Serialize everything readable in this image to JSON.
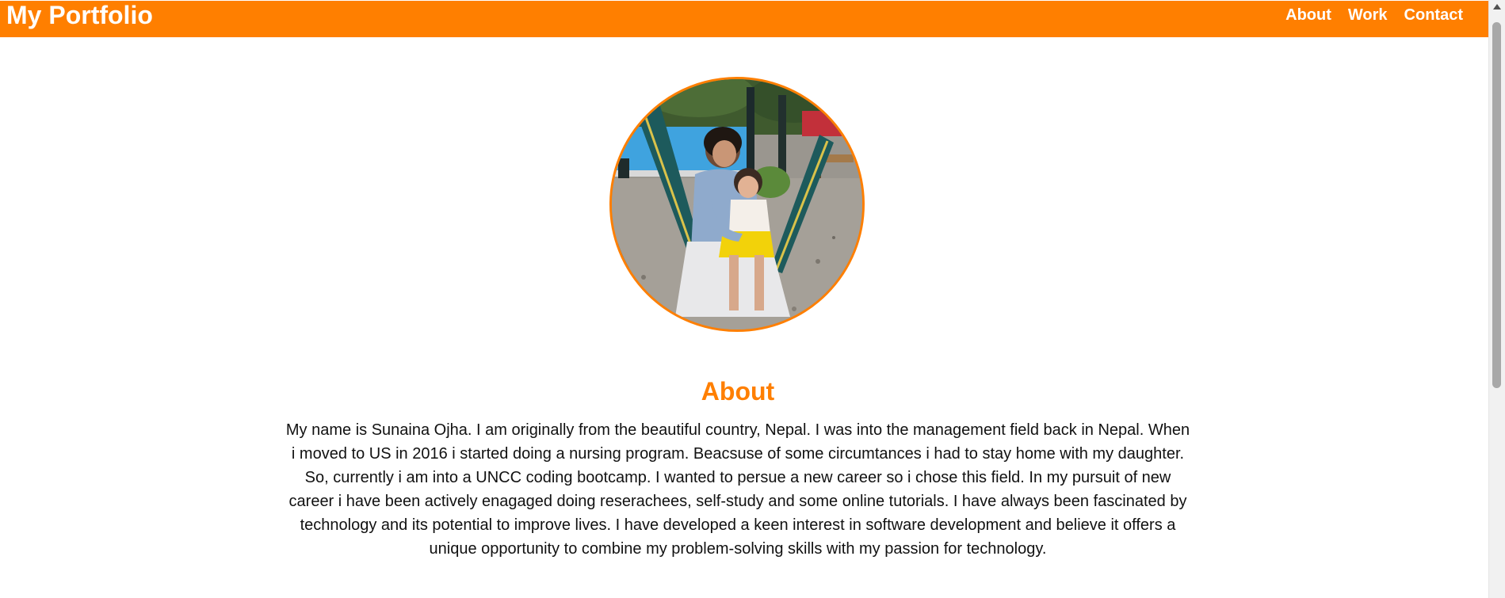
{
  "header": {
    "brand": "My Portfolio",
    "nav": [
      {
        "label": "About"
      },
      {
        "label": "Work"
      },
      {
        "label": "Contact"
      }
    ]
  },
  "profile": {
    "photo_alt": "Profile photo of a woman and her daughter sitting in a hammock"
  },
  "about": {
    "title": "About",
    "text": "My name is Sunaina Ojha. I am originally from the beautiful country, Nepal. I was into the management field back in Nepal. When i moved to US in 2016 i started doing a nursing program. Beacsuse of some circumtances i had to stay home with my daughter. So, currently i am into a UNCC coding bootcamp. I wanted to persue a new career so i chose this field. In my pursuit of new career i have been actively enagaged doing reserachees, self-study and some online tutorials. I have always been fascinated by technology and its potential to improve lives. I have developed a keen interest in software development and believe it offers a unique opportunity to combine my problem-solving skills with my passion for technology."
  },
  "colors": {
    "accent": "#ff7f00",
    "header_text": "#ffffff",
    "body_text": "#111111"
  }
}
